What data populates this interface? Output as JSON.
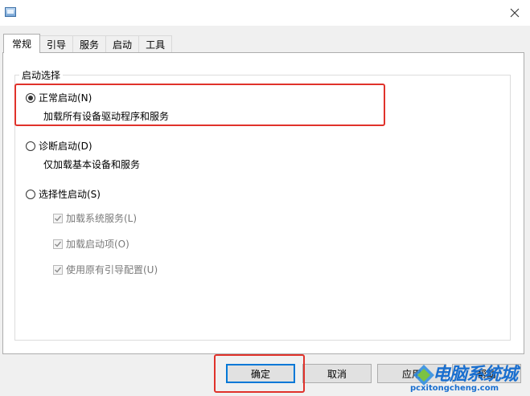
{
  "tabs": [
    {
      "label": "常规",
      "active": true
    },
    {
      "label": "引导",
      "active": false
    },
    {
      "label": "服务",
      "active": false
    },
    {
      "label": "启动",
      "active": false
    },
    {
      "label": "工具",
      "active": false
    }
  ],
  "startup_group": {
    "legend": "启动选择",
    "normal": {
      "label": "正常启动(N)",
      "description": "加载所有设备驱动程序和服务",
      "checked": true
    },
    "diagnostic": {
      "label": "诊断启动(D)",
      "description": "仅加载基本设备和服务",
      "checked": false
    },
    "selective": {
      "label": "选择性启动(S)",
      "checked": false,
      "options": [
        {
          "label": "加载系统服务(L)",
          "checked": true,
          "enabled": false
        },
        {
          "label": "加载启动项(O)",
          "checked": true,
          "enabled": false
        },
        {
          "label": "使用原有引导配置(U)",
          "checked": true,
          "enabled": false
        }
      ]
    }
  },
  "buttons": {
    "ok": "确定",
    "cancel": "取消",
    "apply": "应用",
    "help": "帮助"
  },
  "watermark": {
    "text": "电脑系统城",
    "url": "pcxitongcheng.com"
  },
  "colors": {
    "highlight": "#e0322b",
    "accent": "#0078d7"
  }
}
